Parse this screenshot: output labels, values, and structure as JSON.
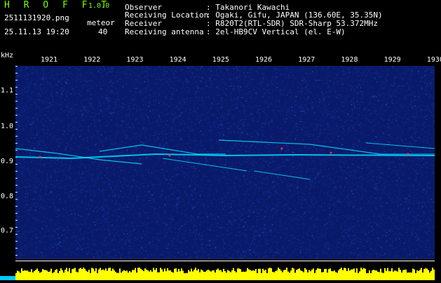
{
  "header": {
    "app_name": "H R O F F T",
    "app_version": "1.0.0",
    "filename": "2511131920.png",
    "timestamp": "25.11.13 19:20",
    "meteor_label": "meteor",
    "meteor_count": "40",
    "info": [
      {
        "key": "Observer",
        "sep": ": ",
        "value": "Takanori Kawachi"
      },
      {
        "key": "Receiving Location",
        "sep": ": ",
        "value": "Ogaki, Gifu, JAPAN (136.60E, 35.35N)"
      },
      {
        "key": "Receiver",
        "sep": ": ",
        "value": "R820T2(RTL-SDR) SDR-Sharp 53.372MHz"
      },
      {
        "key": "Receiving antenna",
        "sep": ": ",
        "value": "2el-HB9CV Vertical (el. E-W)"
      }
    ]
  },
  "spectrogram": {
    "y_unit": "kHz",
    "x_ticks": [
      "1921",
      "1922",
      "1923",
      "1924",
      "1925",
      "1926",
      "1927",
      "1928",
      "1929",
      "1930"
    ],
    "y_ticks": [
      "1.1",
      "1.0",
      "0.9",
      "0.8",
      "0.7",
      "0.6"
    ],
    "colors": {
      "background": "#0a1a6a",
      "trace_main": "#00e0ff",
      "trace_hot": "#ff3030",
      "noise_floor": "#ffff00",
      "header_green": "#7cff00"
    }
  }
}
